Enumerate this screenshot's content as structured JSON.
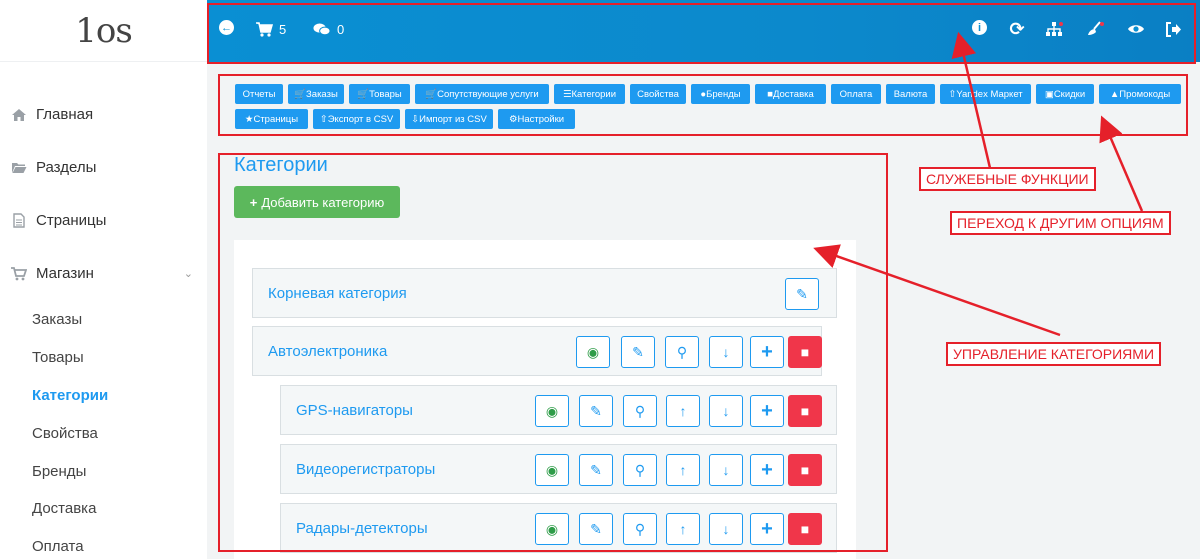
{
  "sidebar": {
    "logo": "1os",
    "nav": [
      {
        "label": "Главная"
      },
      {
        "label": "Разделы"
      },
      {
        "label": "Страницы"
      },
      {
        "label": "Магазин"
      }
    ],
    "sub": [
      "Заказы",
      "Товары",
      "Категории",
      "Свойства",
      "Бренды",
      "Доставка",
      "Оплата"
    ]
  },
  "topbar": {
    "cart_count": "5",
    "comments_count": "0"
  },
  "options": [
    "Отчеты",
    "Заказы",
    "Товары",
    "Сопутствующие услуги",
    "Категории",
    "Свойства",
    "Бренды",
    "Доставка",
    "Оплата",
    "Валюта",
    "Yandex Маркет",
    "Скидки",
    "Промокоды",
    "Страницы",
    "Экспорт в CSV",
    "Импорт из CSV",
    "Настройки"
  ],
  "main": {
    "title": "Категории",
    "add_button": "Добавить категорию",
    "rows": [
      {
        "label": "Корневая категория"
      },
      {
        "label": "Автоэлектроника"
      },
      {
        "label": "GPS-навигаторы"
      },
      {
        "label": "Видеорегистраторы"
      },
      {
        "label": "Радары-детекторы"
      }
    ]
  },
  "annotations": {
    "service": "СЛУЖЕБНЫЕ ФУНКЦИИ",
    "other": "ПЕРЕХОД К ДРУГИМ ОПЦИЯМ",
    "manage": "УПРАВЛЕНИЕ КАТЕГОРИЯМИ"
  },
  "colors": {
    "accent": "#1e9af0",
    "topbar": "#0a8fd3",
    "add": "#5cb85c",
    "delete": "#f0364a",
    "annotation": "#e5202a"
  }
}
